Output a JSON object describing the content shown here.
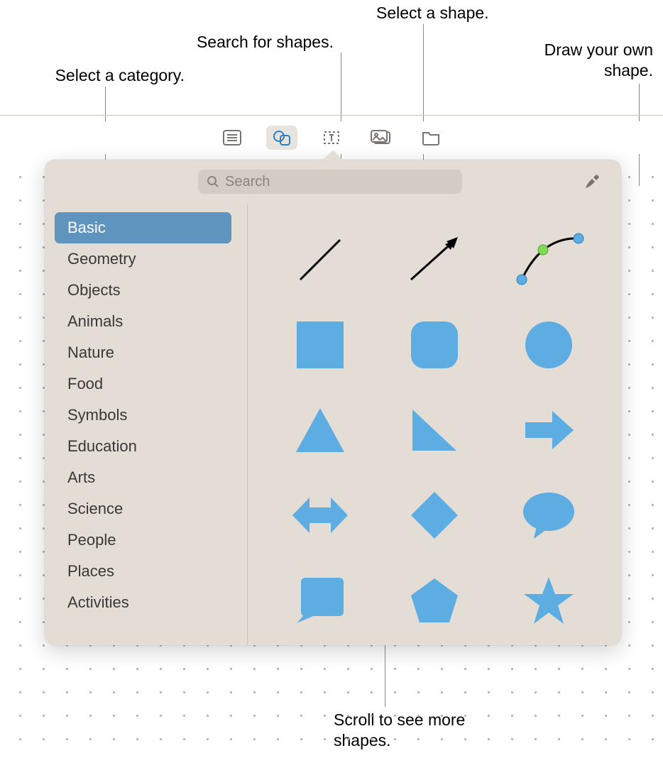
{
  "callouts": {
    "category": "Select a category.",
    "search": "Search for shapes.",
    "shape": "Select a shape.",
    "draw": "Draw your own shape.",
    "scroll": "Scroll to see more shapes."
  },
  "toolbar": {
    "buttons": [
      "list-view",
      "shapes",
      "text-box",
      "image",
      "folder"
    ],
    "active": "shapes"
  },
  "search": {
    "placeholder": "Search"
  },
  "sidebar": {
    "categories": [
      "Basic",
      "Geometry",
      "Objects",
      "Animals",
      "Nature",
      "Food",
      "Symbols",
      "Education",
      "Arts",
      "Science",
      "People",
      "Places",
      "Activities"
    ],
    "selected": "Basic"
  },
  "shapes": [
    {
      "name": "line"
    },
    {
      "name": "arrow-line"
    },
    {
      "name": "curve-editable"
    },
    {
      "name": "square"
    },
    {
      "name": "rounded-square"
    },
    {
      "name": "circle"
    },
    {
      "name": "triangle"
    },
    {
      "name": "right-triangle"
    },
    {
      "name": "arrow-right"
    },
    {
      "name": "arrow-double"
    },
    {
      "name": "diamond"
    },
    {
      "name": "speech-bubble"
    },
    {
      "name": "callout-square"
    },
    {
      "name": "pentagon"
    },
    {
      "name": "star"
    }
  ],
  "colors": {
    "shape_fill": "#5dade2",
    "panel_bg": "#e3ddd6",
    "selected_bg": "#5f94bf"
  }
}
